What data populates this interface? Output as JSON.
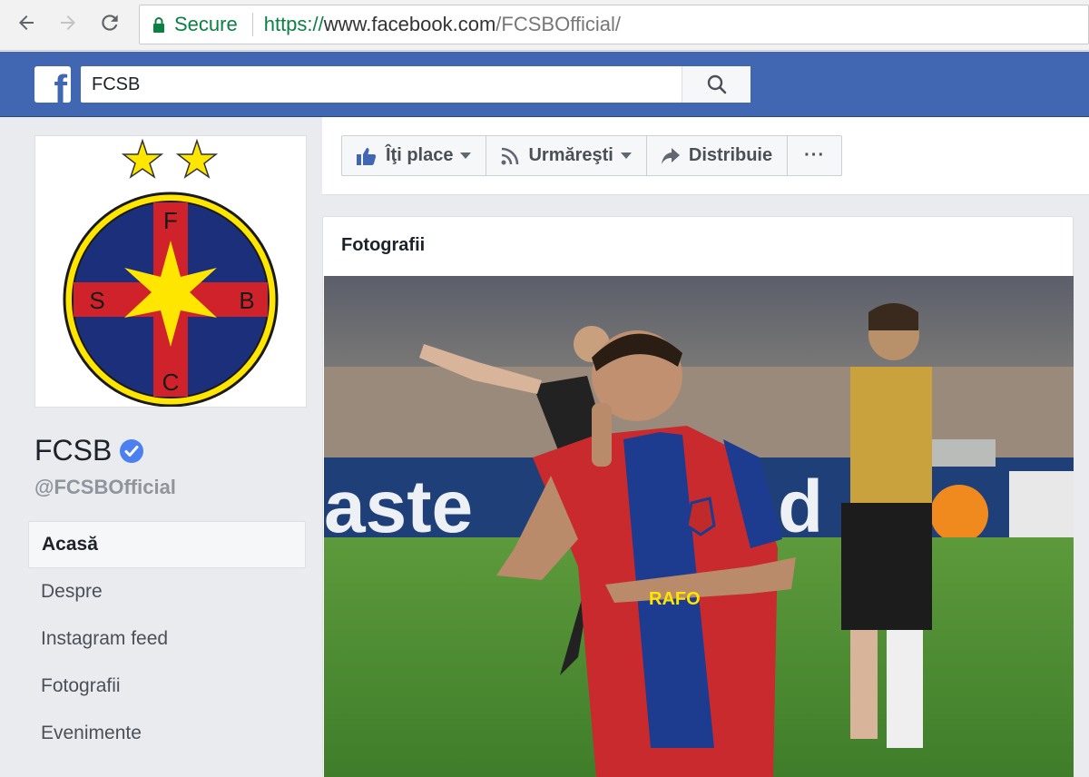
{
  "browser": {
    "secure_label": "Secure",
    "url_scheme": "https://",
    "url_host": "www.facebook.com",
    "url_path": "/FCSBOfficial/"
  },
  "fb": {
    "logo_letter": "f",
    "search_value": "FCSB"
  },
  "page": {
    "name": "FCSB",
    "handle": "@FCSBOfficial",
    "crest_letters": [
      "F",
      "S",
      "B",
      "C"
    ]
  },
  "left_nav": [
    {
      "label": "Acasă",
      "active": true
    },
    {
      "label": "Despre"
    },
    {
      "label": "Instagram feed"
    },
    {
      "label": "Fotografii"
    },
    {
      "label": "Evenimente"
    }
  ],
  "actions": {
    "like_label": "Îţi place",
    "follow_label": "Urmăreşti",
    "share_label": "Distribuie",
    "more_label": "···"
  },
  "photos": {
    "title": "Fotografii",
    "ad_board_text": "aste",
    "ad_board_text2": "d",
    "shirt_sponsor": "RAFO"
  },
  "colors": {
    "fb_blue": "#4267b2",
    "secure_green": "#0b8043",
    "crest_blue": "#1c2f7a",
    "crest_red": "#d0222a",
    "crest_yellow": "#ffe600"
  }
}
